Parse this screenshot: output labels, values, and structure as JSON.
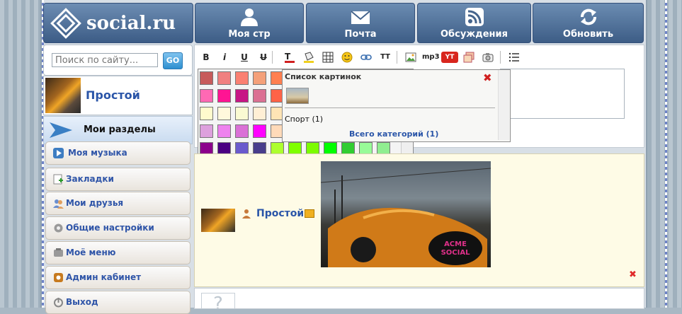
{
  "site": {
    "logo_text": "social.ru"
  },
  "nav": [
    {
      "label": "Моя стр",
      "icon": "user-icon"
    },
    {
      "label": "Почта",
      "icon": "mail-icon"
    },
    {
      "label": "Обсуждения",
      "icon": "rss-icon"
    },
    {
      "label": "Обновить",
      "icon": "refresh-icon"
    }
  ],
  "search": {
    "placeholder": "Поиск по сайту...",
    "go_label": "GO"
  },
  "profile": {
    "name": "Простой"
  },
  "sidebar": {
    "section_title": "Мои разделы",
    "items": [
      {
        "label": "Моя музыка",
        "icon": "play-icon"
      },
      {
        "label": "Закладки",
        "icon": "bookmark-icon"
      },
      {
        "label": "Мои друзья",
        "icon": "friends-icon"
      },
      {
        "label": "Общие  настройки",
        "icon": "gear-icon"
      },
      {
        "label": "Моё меню",
        "icon": "menu-icon"
      },
      {
        "label": "Админ кабинет",
        "icon": "admin-icon"
      },
      {
        "label": "Выход",
        "icon": "power-icon"
      }
    ]
  },
  "toolbar": {
    "bold": "B",
    "italic": "i",
    "underline": "U",
    "strike": "U",
    "mp3": "mp3",
    "youtube": "You\nTube",
    "tt": "TT"
  },
  "palette": {
    "colors": [
      [
        "#c75b5b",
        "#f08080",
        "#fa8072",
        "#f4a07a",
        "#ff7f50"
      ],
      [
        "#ff69b4",
        "#ff1493",
        "#c71585",
        "#db7093",
        "#ff6347"
      ],
      [
        "#fffacd",
        "#fff8dc",
        "#fafad2",
        "#ffefd5",
        "#ffe4b5"
      ],
      [
        "#dda0dd",
        "#ee82ee",
        "#da70d6",
        "#ff00ff",
        "#ffdab9"
      ],
      [
        "#8b008b",
        "#4b0082",
        "#6a5acd",
        "#483d8b",
        "#adff2f",
        "#7fff00",
        "#7cfc00",
        "#00ff00",
        "#32cd32",
        "#98fb98",
        "#90ee90"
      ],
      [
        "#00fa9a",
        "#00ff7f",
        "#3cb371",
        "#2e8b57",
        "#228b22",
        "#008000",
        "#006400",
        "#6b8e23",
        "#556b2f",
        "#808000",
        "#556b3f"
      ],
      [
        "#66cdaa",
        "#8fbc8f",
        "#20b2aa",
        "#008b8b",
        "#008080",
        "#00ffff",
        "#00ffff",
        "#e0ffff",
        "#afeeee",
        "#7fffd4",
        "#40e0d0"
      ],
      [
        "#48d1cc",
        "#00ced1",
        "#5f9ea0",
        "#4682b4",
        "#b0c4de",
        "#b0e0e6",
        "#add8e6",
        "#87ceeb",
        "#87cefa",
        "#00bfff",
        "#1e90ff"
      ]
    ]
  },
  "image_list": {
    "title": "Список картинок",
    "category": "Спорт (1)",
    "total": "Всего категорий (1)"
  },
  "post": {
    "author": "Простой",
    "watermark": "ACME SOCIAL"
  },
  "bottom": {
    "glyph": "?"
  }
}
